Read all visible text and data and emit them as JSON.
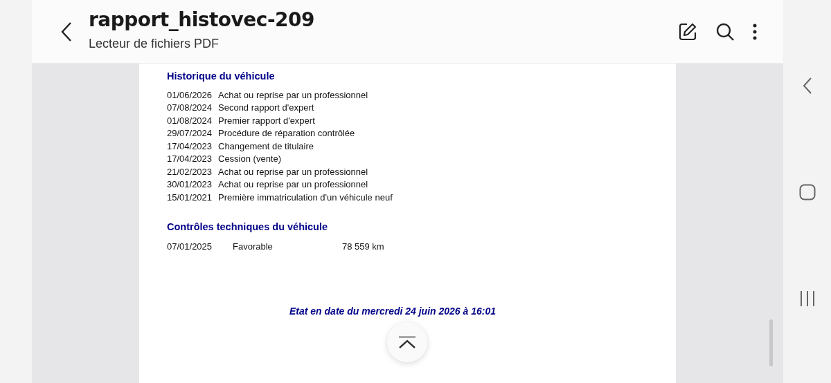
{
  "header": {
    "title": "rapport_histovec-209",
    "subtitle": "Lecteur de fichiers PDF"
  },
  "document": {
    "history": {
      "heading": "Historique du véhicule",
      "rows": [
        {
          "date": "01/06/2026",
          "event": "Achat ou reprise par un professionnel"
        },
        {
          "date": "07/08/2024",
          "event": "Second rapport d'expert"
        },
        {
          "date": "01/08/2024",
          "event": "Premier rapport d'expert"
        },
        {
          "date": "29/07/2024",
          "event": "Procédure de réparation contrôlée"
        },
        {
          "date": "17/04/2023",
          "event": "Changement de titulaire"
        },
        {
          "date": "17/04/2023",
          "event": "Cession (vente)"
        },
        {
          "date": "21/02/2023",
          "event": "Achat ou reprise par un professionnel"
        },
        {
          "date": "30/01/2023",
          "event": "Achat ou reprise par un professionnel"
        },
        {
          "date": "15/01/2021",
          "event": "Première immatriculation d'un véhicule neuf"
        }
      ]
    },
    "inspections": {
      "heading": "Contrôles techniques du véhicule",
      "rows": [
        {
          "date": "07/01/2025",
          "result": "Favorable",
          "mileage": "78 559 km"
        }
      ]
    },
    "footer": "Etat en date du mercredi 24 juin 2026 à 16:01"
  }
}
